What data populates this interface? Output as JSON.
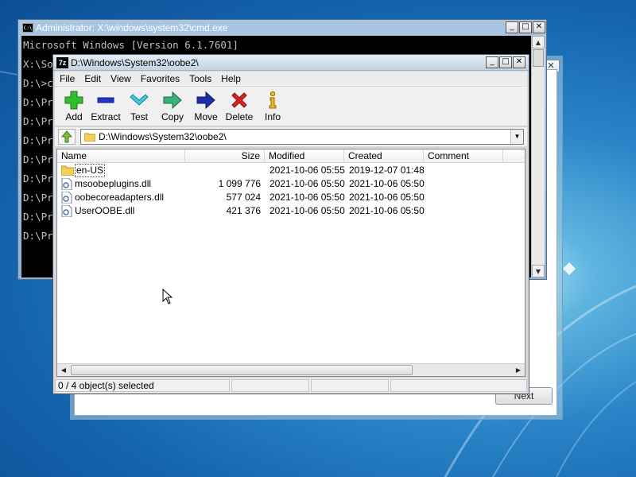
{
  "setup": {
    "close_label": "✕",
    "next_label": "Next"
  },
  "cmd": {
    "title": "Administrator: X:\\windows\\system32\\cmd.exe",
    "icon_text": "C:\\",
    "caption_buttons": [
      "_",
      "□",
      "✕"
    ],
    "lines": [
      "Microsoft Windows [Version 6.1.7601]",
      "",
      "X:\\So",
      "D:\\>c",
      "D:\\Pr",
      "D:\\Pr",
      "D:\\Pr",
      "D:\\Pr",
      "D:\\Pr",
      "D:\\Pr",
      "D:\\Pr",
      "D:\\Pr"
    ]
  },
  "fm": {
    "title": "D:\\Windows\\System32\\oobe2\\",
    "icon_text": "7z",
    "caption_buttons": [
      "_",
      "□",
      "✕"
    ],
    "menu": [
      "File",
      "Edit",
      "View",
      "Favorites",
      "Tools",
      "Help"
    ],
    "toolbar": {
      "add": "Add",
      "extract": "Extract",
      "test": "Test",
      "copy": "Copy",
      "move": "Move",
      "delete": "Delete",
      "info": "Info"
    },
    "path": "D:\\Windows\\System32\\oobe2\\",
    "columns": [
      "Name",
      "Size",
      "Modified",
      "Created",
      "Comment"
    ],
    "rows": [
      {
        "name": "en-US",
        "size": "",
        "modified": "2021-10-06 05:55",
        "created": "2019-12-07 01:48",
        "comment": "",
        "icon": "folder-icon"
      },
      {
        "name": "msoobeplugins.dll",
        "size": "1 099 776",
        "modified": "2021-10-06 05:50",
        "created": "2021-10-06 05:50",
        "comment": "",
        "icon": "dll-file-icon"
      },
      {
        "name": "oobecoreadapters.dll",
        "size": "577 024",
        "modified": "2021-10-06 05:50",
        "created": "2021-10-06 05:50",
        "comment": "",
        "icon": "dll-file-icon"
      },
      {
        "name": "UserOOBE.dll",
        "size": "421 376",
        "modified": "2021-10-06 05:50",
        "created": "2021-10-06 05:50",
        "comment": "",
        "icon": "dll-file-icon"
      }
    ],
    "status": "0 / 4 object(s) selected"
  }
}
